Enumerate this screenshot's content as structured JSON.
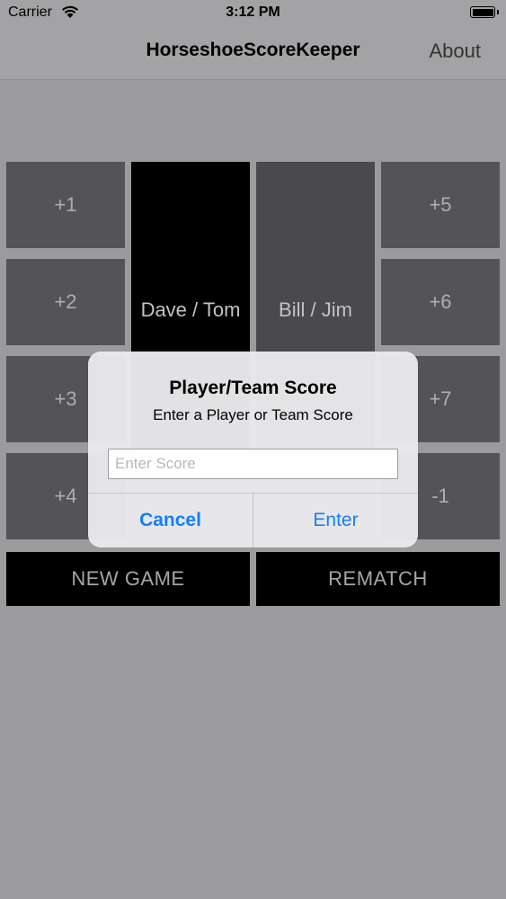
{
  "status": {
    "carrier": "Carrier",
    "time": "3:12 PM"
  },
  "nav": {
    "title": "HorseshoeScoreKeeper",
    "about": "About"
  },
  "left_buttons": [
    "+1",
    "+2",
    "+3",
    "+4"
  ],
  "right_buttons": [
    "+5",
    "+6",
    "+7",
    "-1"
  ],
  "players": {
    "left": "Dave / Tom",
    "right": "Bill / Jim"
  },
  "actions": {
    "new_game": "NEW GAME",
    "rematch": "REMATCH"
  },
  "alert": {
    "title": "Player/Team Score",
    "message": "Enter a Player or Team Score",
    "input_placeholder": "Enter Score",
    "input_value": "",
    "cancel": "Cancel",
    "enter": "Enter"
  },
  "colors": {
    "accent": "#157efb",
    "tile": "#545355",
    "player_left_bg": "#000000",
    "player_right_bg": "#4a494b",
    "dim_background": "#9b9a9c"
  }
}
